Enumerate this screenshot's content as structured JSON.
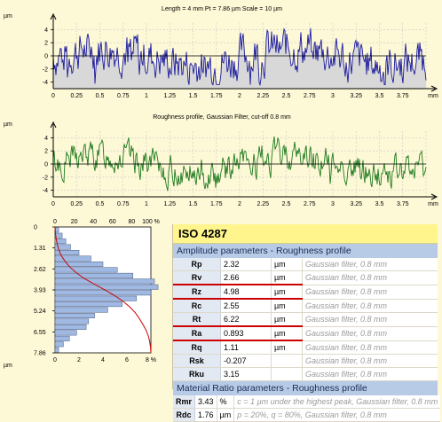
{
  "chart_data": [
    {
      "type": "line",
      "title": "Length = 4 mm  Pt = 7.86 µm  Scale = 10 µm",
      "ylabel": "µm",
      "xlabel": "mm",
      "xlim": [
        0,
        4
      ],
      "ylim": [
        -5,
        5
      ],
      "x_ticks": [
        "0",
        "0.25",
        "0.5",
        "0.75",
        "1",
        "1.25",
        "1.5",
        "1.75",
        "2",
        "2.25",
        "2.5",
        "2.75",
        "3",
        "3.25",
        "3.5",
        "3.75",
        "mm"
      ],
      "y_ticks": [
        "4",
        "2",
        "0",
        "-2",
        "-4"
      ],
      "series": [
        {
          "color": "#1a1a9e",
          "fill": "#d8d8d8",
          "amplitude": 2.2,
          "seed": 7
        }
      ]
    },
    {
      "type": "line",
      "title": "Roughness profile, Gaussian Filter, cut-off 0.8 mm",
      "ylabel": "µm",
      "xlabel": "mm",
      "xlim": [
        0,
        4
      ],
      "ylim": [
        -5,
        5
      ],
      "x_ticks": [
        "0",
        "0.25",
        "0.5",
        "0.75",
        "1",
        "1.25",
        "1.5",
        "1.75",
        "2",
        "2.25",
        "2.5",
        "2.75",
        "3",
        "3.25",
        "3.5",
        "3.75",
        "mm"
      ],
      "y_ticks": [
        "4",
        "2",
        "0",
        "-2",
        "-4"
      ],
      "series": [
        {
          "color": "#1e7a1e",
          "amplitude": 1.6,
          "seed": 13
        }
      ]
    },
    {
      "type": "bar",
      "orientation": "horizontal",
      "ylabel": "µm",
      "top_ticks": [
        "0",
        "20",
        "40",
        "60",
        "80",
        "100 %"
      ],
      "bottom_ticks": [
        "0",
        "2",
        "4",
        "6",
        "8 %"
      ],
      "y_ticks": [
        "0",
        "1.31",
        "2.62",
        "3.93",
        "5.24",
        "6.55",
        "7.86"
      ],
      "ylim": [
        0,
        7.86
      ],
      "distribution_percent": [
        0.3,
        0.6,
        0.9,
        1.3,
        2.0,
        3.0,
        4.0,
        5.2,
        6.5,
        8.3,
        8.6,
        8.0,
        6.8,
        5.6,
        4.4,
        3.3,
        2.8,
        2.6,
        1.8,
        1.2,
        0.7,
        0.3
      ],
      "curve_color": "#cc0000",
      "bar_color": "#9fb9e3"
    }
  ],
  "iso": {
    "title": "ISO 4287",
    "amplitude_header": "Amplitude parameters - Roughness profile",
    "amplitude_rows": [
      {
        "name": "Rp",
        "value": "2.32",
        "unit": "µm",
        "note": "Gaussian filter, 0.8 mm",
        "hl": false
      },
      {
        "name": "Rv",
        "value": "2.66",
        "unit": "µm",
        "note": "Gaussian filter, 0.8 mm",
        "hl": true
      },
      {
        "name": "Rz",
        "value": "4.98",
        "unit": "µm",
        "note": "Gaussian filter, 0.8 mm",
        "hl": true
      },
      {
        "name": "Rc",
        "value": "2.55",
        "unit": "µm",
        "note": "Gaussian filter, 0.8 mm",
        "hl": false
      },
      {
        "name": "Rt",
        "value": "6.22",
        "unit": "µm",
        "note": "Gaussian filter, 0.8 mm",
        "hl": true
      },
      {
        "name": "Ra",
        "value": "0.893",
        "unit": "µm",
        "note": "Gaussian filter, 0.8 mm",
        "hl": true
      },
      {
        "name": "Rq",
        "value": "1.11",
        "unit": "µm",
        "note": "Gaussian filter, 0.8 mm",
        "hl": false
      },
      {
        "name": "Rsk",
        "value": "-0.207",
        "unit": "",
        "note": "Gaussian filter, 0.8 mm",
        "hl": false
      },
      {
        "name": "Rku",
        "value": "3.15",
        "unit": "",
        "note": "Gaussian filter, 0.8 mm",
        "hl": false
      }
    ],
    "material_header": "Material Ratio parameters - Roughness profile",
    "material_rows": [
      {
        "name": "Rmr",
        "value": "3.43",
        "unit": "%",
        "note": "c = 1 µm under the highest peak, Gaussian filter, 0.8 mm"
      },
      {
        "name": "Rdc",
        "value": "1.76",
        "unit": "µm",
        "note": "p = 20%, q = 80%, Gaussian filter, 0.8 mm"
      }
    ]
  }
}
